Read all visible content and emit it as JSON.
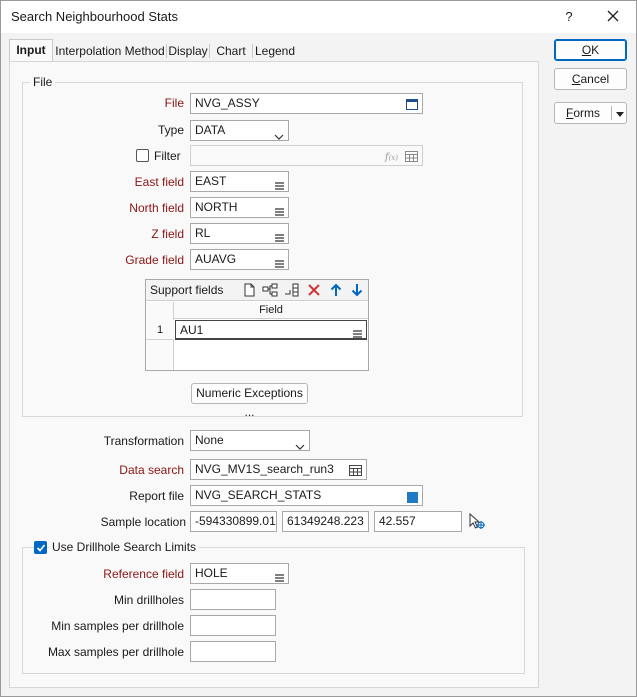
{
  "window": {
    "title": "Search Neighbourhood Stats",
    "help_label": "?"
  },
  "tabs": [
    {
      "label": "Input"
    },
    {
      "label": "Interpolation Method"
    },
    {
      "label": "Display"
    },
    {
      "label": "Chart"
    },
    {
      "label": "Legend"
    }
  ],
  "buttons": {
    "ok_underlined": "O",
    "ok_rest": "K",
    "cancel_underlined": "C",
    "cancel_rest": "ancel",
    "forms_underlined": "F",
    "forms_rest": "orms"
  },
  "file_group": {
    "title": "File",
    "file_label": "File",
    "file_value": "NVG_ASSY",
    "type_label": "Type",
    "type_value": "DATA",
    "filter_label": "Filter",
    "filter_value": "",
    "filter_checked": false,
    "east_label": "East field",
    "east_value": "EAST",
    "north_label": "North field",
    "north_value": "NORTH",
    "z_label": "Z field",
    "z_value": "RL",
    "grade_label": "Grade field",
    "grade_value": "AUAVG"
  },
  "support_fields": {
    "title": "Support fields",
    "column_header": "Field",
    "rows": [
      {
        "num": "1",
        "field": "AU1"
      }
    ]
  },
  "numeric_exceptions_label": "Numeric Exceptions ...",
  "settings": {
    "transformation_label": "Transformation",
    "transformation_value": "None",
    "data_search_label": "Data search",
    "data_search_value": "NVG_MV1S_search_run3",
    "report_file_label": "Report file",
    "report_file_value": "NVG_SEARCH_STATS",
    "sample_location_label": "Sample location",
    "sample_x": "-594330899.012",
    "sample_y": "61349248.223",
    "sample_z": "42.557"
  },
  "drillhole": {
    "title": "Use Drillhole Search Limits",
    "checked": true,
    "reference_label": "Reference field",
    "reference_value": "HOLE",
    "min_drillholes_label": "Min drillholes",
    "min_drillholes_value": "",
    "min_samples_label": "Min samples per drillhole",
    "min_samples_value": "",
    "max_samples_label": "Max samples per drillhole",
    "max_samples_value": ""
  },
  "colors": {
    "accent": "#0067c0",
    "required_label": "#8b1414",
    "delete_icon": "#d13438"
  }
}
